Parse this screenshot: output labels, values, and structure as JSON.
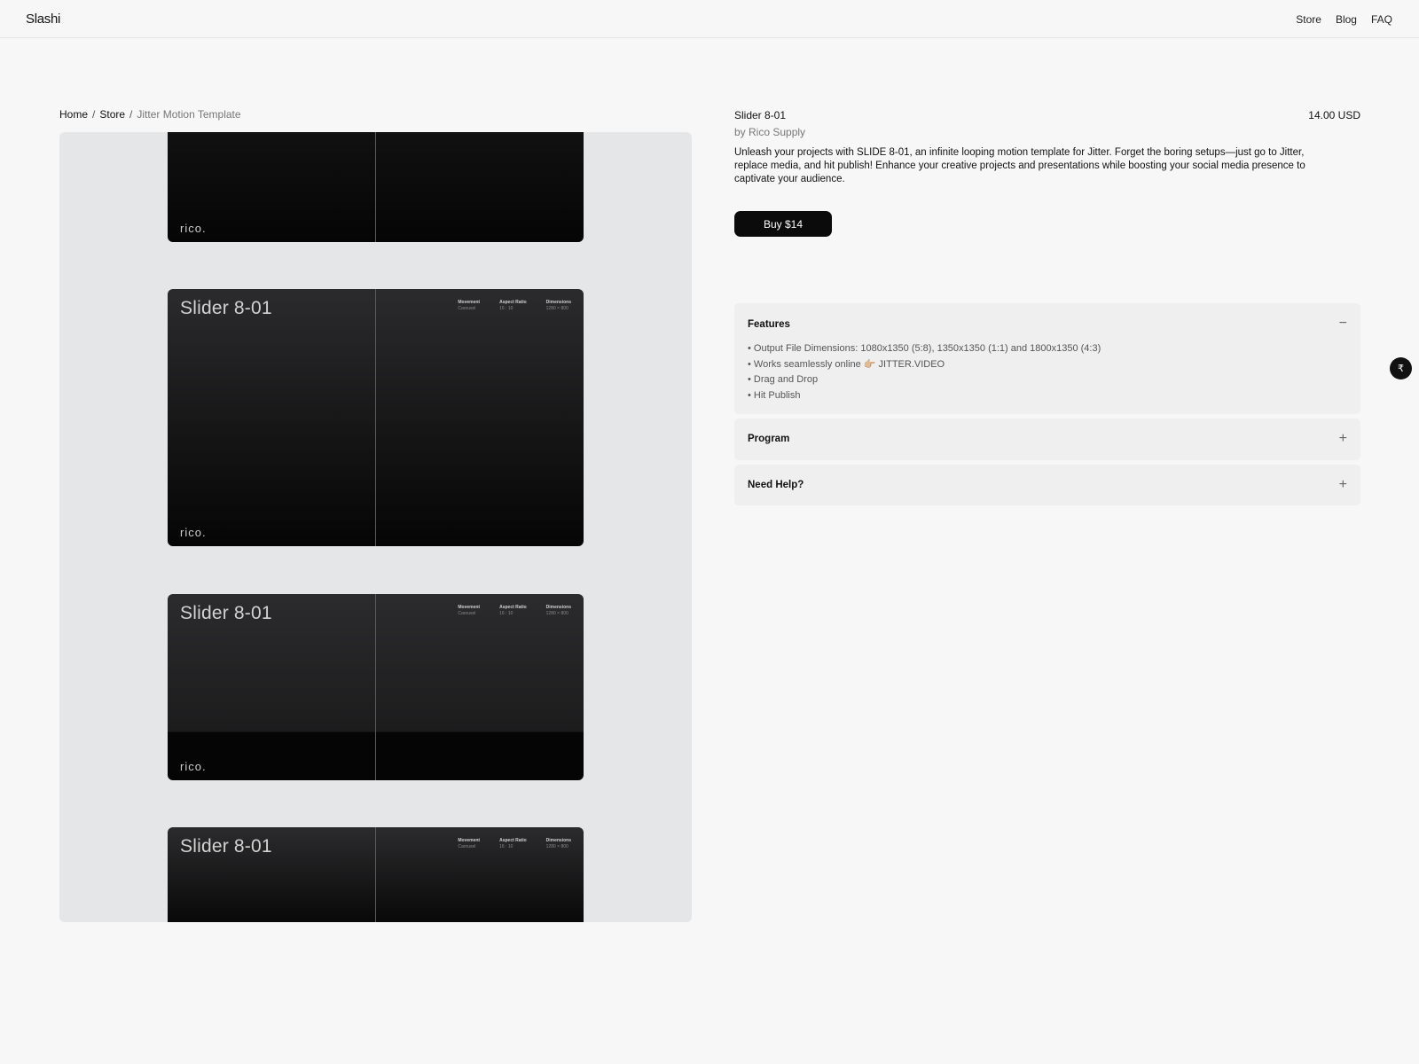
{
  "header": {
    "logo": "Slashi",
    "nav": [
      "Store",
      "Blog",
      "FAQ"
    ]
  },
  "breadcrumb": {
    "home": "Home",
    "sep": "/",
    "store": "Store",
    "current": "Jitter Motion Template"
  },
  "gallery": {
    "slide_title": "Slider 8-01",
    "brand": "rico.",
    "meta": [
      {
        "label": "Movement",
        "value": "Carousel"
      },
      {
        "label": "Aspect Ratio",
        "value": "16 : 10"
      },
      {
        "label": "Dimensions",
        "value": "1280 × 800"
      }
    ]
  },
  "product": {
    "title": "Slider 8-01",
    "price": "14.00 USD",
    "byline": "by  Rico Supply",
    "description": "Unleash your projects with SLIDE 8-01, an infinite looping motion template for Jitter. Forget the boring setups—just go to Jitter, replace media, and hit publish! Enhance your creative projects and presentations while boosting your social media presence to captivate your audience.",
    "buy_label": "Buy $14"
  },
  "accordions": {
    "features": {
      "title": "Features",
      "toggle": "−",
      "items": [
        "• Output File Dimensions: 1080x1350 (5:8), 1350x1350 (1:1) and 1800x1350  (4:3)",
        "• Works seamlessly online 👉🏼 JITTER.VIDEO",
        "• Drag and Drop",
        "• Hit Publish"
      ]
    },
    "program": {
      "title": "Program",
      "toggle": "+"
    },
    "help": {
      "title": "Need Help?",
      "toggle": "+"
    }
  },
  "fab": {
    "icon": "₹",
    "icon_name": "currency-icon"
  }
}
